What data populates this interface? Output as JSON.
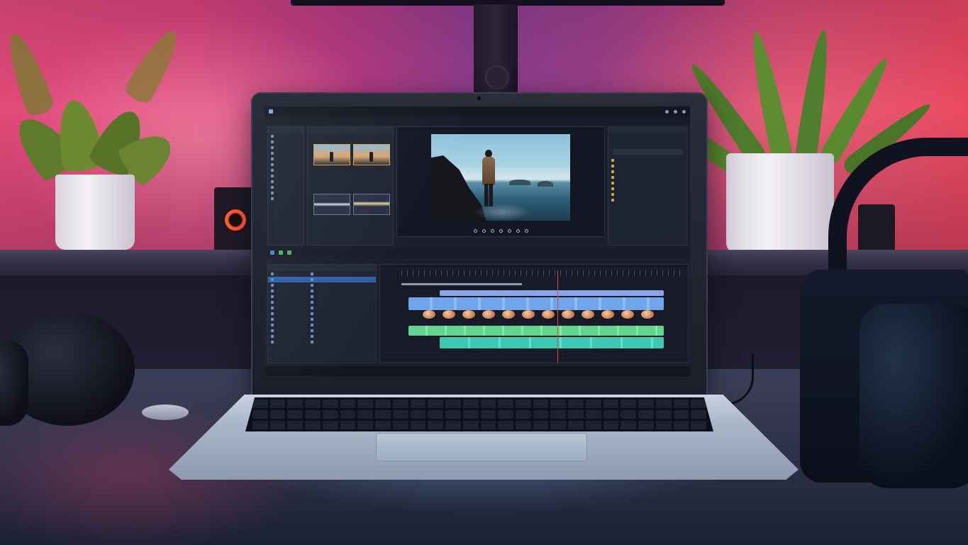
{
  "scene": {
    "setting": "",
    "colors": {
      "wall_left": "#e24a79",
      "wall_right": "#e9465e",
      "screen_bg": "#1a1f2b",
      "track_blue": "#4f8fe0",
      "track_green": "#5fd48c",
      "track_cyan": "#3fc7c2",
      "speaker_ring": "#ff4f3b"
    }
  },
  "editor": {
    "title_text": "",
    "menu_items": [],
    "status_items": [],
    "icons": [
      "play-icon",
      "pause-icon",
      "stop-icon",
      "scissors-icon",
      "folder-icon"
    ]
  }
}
